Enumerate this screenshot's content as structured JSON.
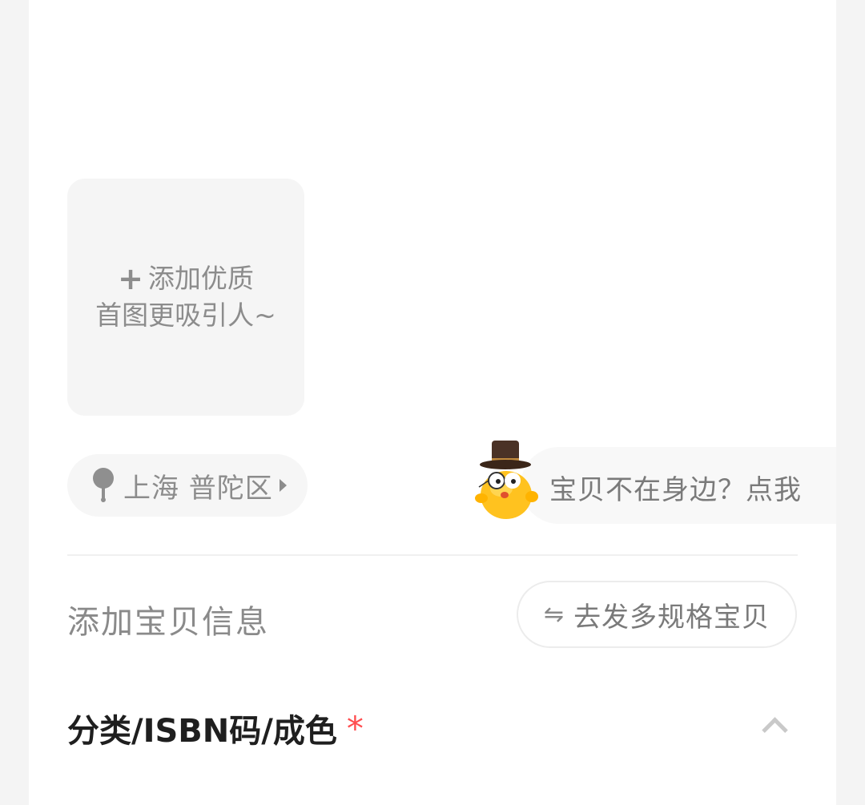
{
  "photo_upload": {
    "plus": "+",
    "line1": "添加优质",
    "line2": "首图更吸引人~"
  },
  "location": {
    "text": "上海 普陀区"
  },
  "helper": {
    "text": "宝贝不在身边？点我"
  },
  "section": {
    "title": "添加宝贝信息",
    "multi_spec_icon": "⇋",
    "multi_spec_label": "去发多规格宝贝"
  },
  "category": {
    "label": "分类/ISBN码/成色",
    "required_mark": "*"
  },
  "icons": {
    "location": "location-pin-icon",
    "swap": "swap-arrows-icon",
    "collapse": "chevron-up-icon",
    "mascot": "mascot-icon"
  },
  "colors": {
    "required": "#ff4d4f",
    "muted_text": "#8c8c8c",
    "tile_bg": "#f5f5f5"
  }
}
